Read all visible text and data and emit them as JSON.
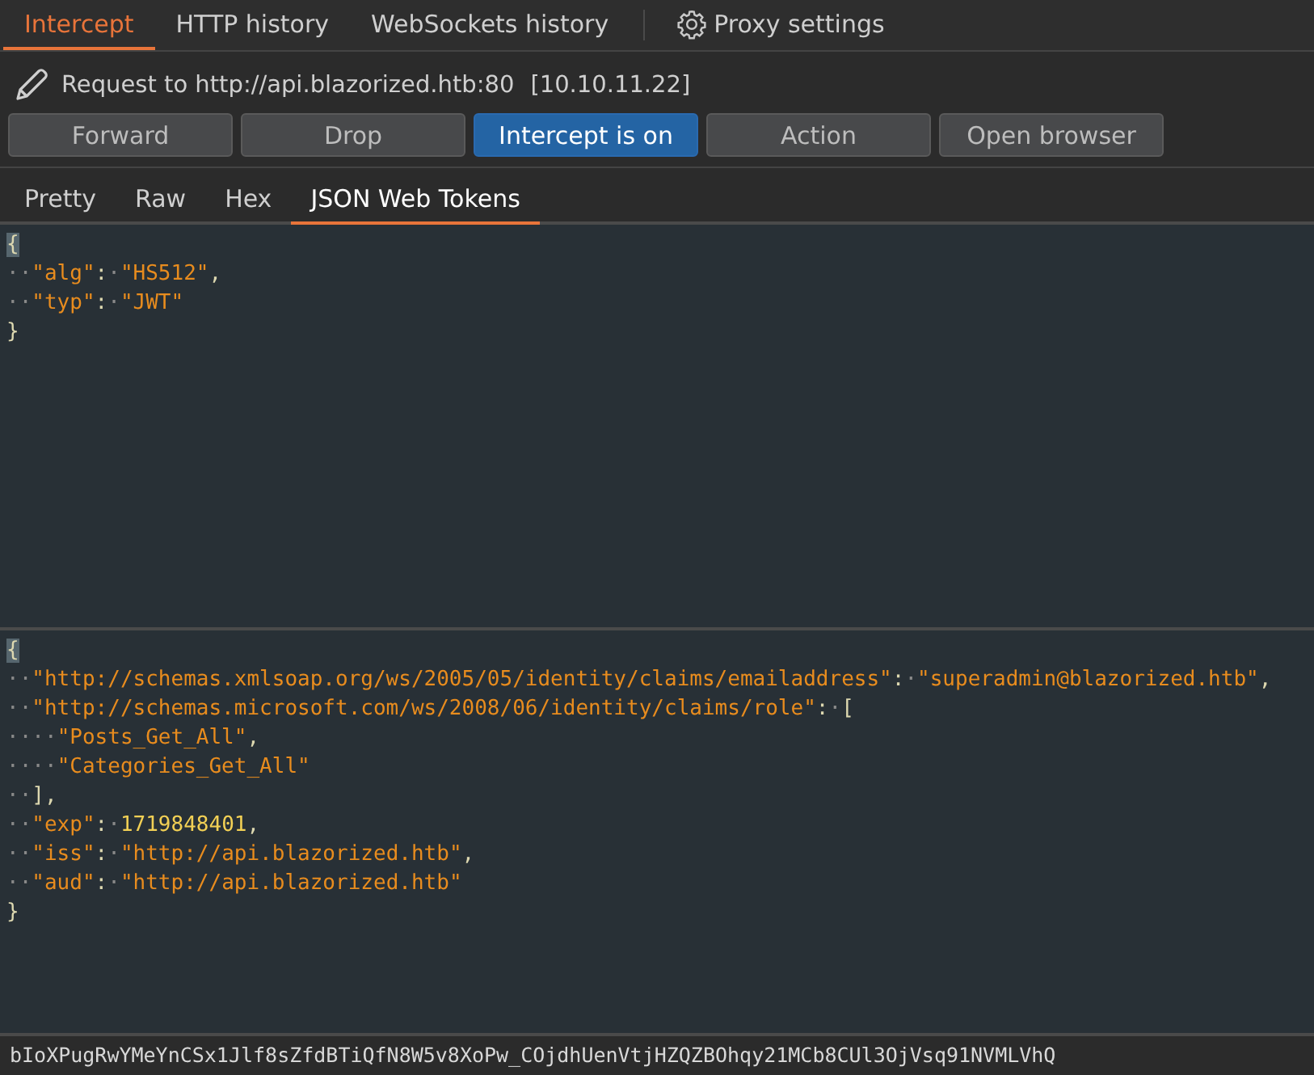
{
  "main_tabs": [
    {
      "label": "Intercept",
      "selected": true,
      "kind": "tab"
    },
    {
      "label": "HTTP history",
      "selected": false,
      "kind": "tab"
    },
    {
      "label": "WebSockets history",
      "selected": false,
      "kind": "tab"
    },
    {
      "label": "Proxy settings",
      "selected": false,
      "kind": "settings"
    }
  ],
  "request": {
    "label": "Request to http://api.blazorized.htb:80",
    "address": "[10.10.11.22]"
  },
  "buttons": [
    {
      "label": "Forward",
      "selected": false
    },
    {
      "label": "Drop",
      "selected": false
    },
    {
      "label": "Intercept is on",
      "selected": true
    },
    {
      "label": "Action",
      "selected": false
    },
    {
      "label": "Open browser",
      "selected": false
    }
  ],
  "view_tabs": [
    {
      "label": "Pretty",
      "selected": false
    },
    {
      "label": "Raw",
      "selected": false
    },
    {
      "label": "Hex",
      "selected": false
    },
    {
      "label": "JSON Web Tokens",
      "selected": true
    }
  ],
  "header_pane": {
    "lines": [
      [
        {
          "kind": "brace",
          "text": "{"
        }
      ],
      [
        {
          "kind": "ws",
          "text": "··"
        },
        {
          "kind": "str",
          "text": "\"alg\""
        },
        {
          "kind": "punct",
          "text": ":"
        },
        {
          "kind": "ws",
          "text": "·"
        },
        {
          "kind": "str",
          "text": "\"HS512\""
        },
        {
          "kind": "punct",
          "text": ","
        }
      ],
      [
        {
          "kind": "ws",
          "text": "··"
        },
        {
          "kind": "str",
          "text": "\"typ\""
        },
        {
          "kind": "punct",
          "text": ":"
        },
        {
          "kind": "ws",
          "text": "·"
        },
        {
          "kind": "str",
          "text": "\"JWT\""
        }
      ],
      [
        {
          "kind": "punct",
          "text": "}"
        }
      ]
    ]
  },
  "payload_pane": {
    "lines": [
      [
        {
          "kind": "brace",
          "text": "{"
        }
      ],
      [
        {
          "kind": "ws",
          "text": "··"
        },
        {
          "kind": "str",
          "text": "\"http://schemas.xmlsoap.org/ws/2005/05/identity/claims/emailaddress\""
        },
        {
          "kind": "punct",
          "text": ":"
        },
        {
          "kind": "ws",
          "text": "·"
        },
        {
          "kind": "str",
          "text": "\"superadmin@blazorized.htb\""
        },
        {
          "kind": "punct",
          "text": ","
        }
      ],
      [
        {
          "kind": "ws",
          "text": "··"
        },
        {
          "kind": "str",
          "text": "\"http://schemas.microsoft.com/ws/2008/06/identity/claims/role\""
        },
        {
          "kind": "punct",
          "text": ":"
        },
        {
          "kind": "ws",
          "text": "·"
        },
        {
          "kind": "punct",
          "text": "["
        }
      ],
      [
        {
          "kind": "ws",
          "text": "····"
        },
        {
          "kind": "str",
          "text": "\"Posts_Get_All\""
        },
        {
          "kind": "punct",
          "text": ","
        }
      ],
      [
        {
          "kind": "ws",
          "text": "····"
        },
        {
          "kind": "str",
          "text": "\"Categories_Get_All\""
        }
      ],
      [
        {
          "kind": "ws",
          "text": "··"
        },
        {
          "kind": "punct",
          "text": "],"
        }
      ],
      [
        {
          "kind": "ws",
          "text": "··"
        },
        {
          "kind": "str",
          "text": "\"exp\""
        },
        {
          "kind": "punct",
          "text": ":"
        },
        {
          "kind": "ws",
          "text": "·"
        },
        {
          "kind": "num",
          "text": "1719848401"
        },
        {
          "kind": "punct",
          "text": ","
        }
      ],
      [
        {
          "kind": "ws",
          "text": "··"
        },
        {
          "kind": "str",
          "text": "\"iss\""
        },
        {
          "kind": "punct",
          "text": ":"
        },
        {
          "kind": "ws",
          "text": "·"
        },
        {
          "kind": "str",
          "text": "\"http://api.blazorized.htb\""
        },
        {
          "kind": "punct",
          "text": ","
        }
      ],
      [
        {
          "kind": "ws",
          "text": "··"
        },
        {
          "kind": "str",
          "text": "\"aud\""
        },
        {
          "kind": "punct",
          "text": ":"
        },
        {
          "kind": "ws",
          "text": "·"
        },
        {
          "kind": "str",
          "text": "\"http://api.blazorized.htb\""
        }
      ],
      [
        {
          "kind": "punct",
          "text": "}"
        }
      ]
    ]
  },
  "signature": {
    "value": "bIoXPugRwYMeYnCSx1Jlf8sZfdBTiQfN8W5v8XoPw_COjdhUenVtjHZQZBOhqy21MCb8CUl3OjVsq91NVMLVhQ"
  }
}
